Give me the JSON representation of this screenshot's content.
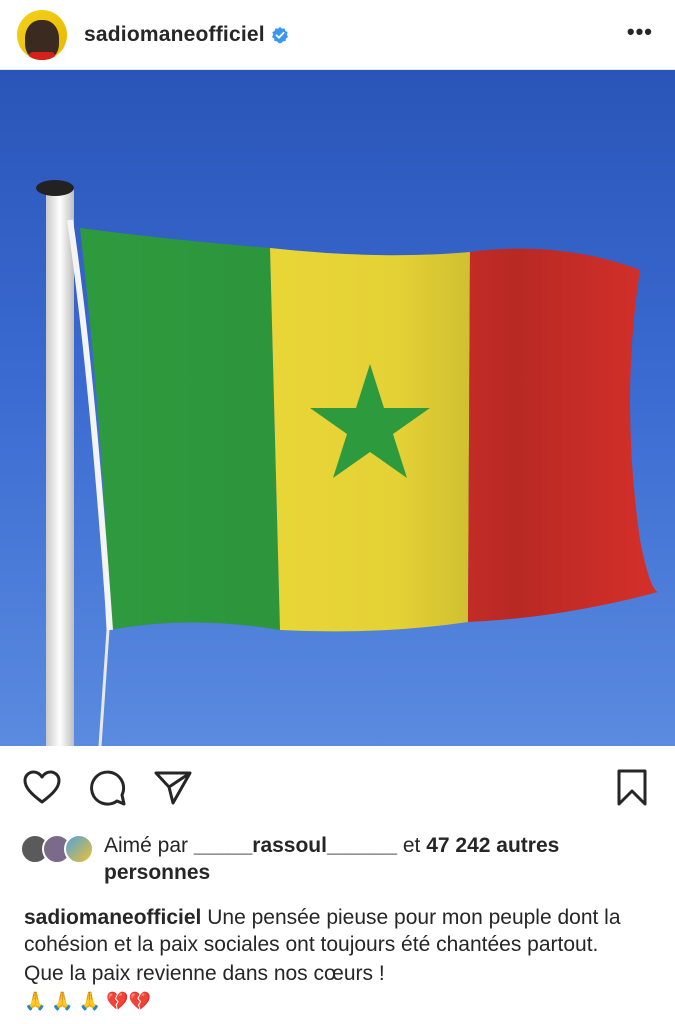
{
  "post": {
    "username": "sadiomaneofficiel",
    "verified_icon": "verified-badge-icon",
    "more_icon": "more-options-icon",
    "more_label": "•••"
  },
  "image": {
    "subject": "Senegal flag",
    "colors": {
      "green": "#2e9a3e",
      "yellow": "#f0dc38",
      "red": "#e0322c",
      "sky": "#2f5fc4"
    }
  },
  "actions": {
    "like_icon": "heart-icon",
    "comment_icon": "comment-icon",
    "share_icon": "send-icon",
    "save_icon": "bookmark-icon"
  },
  "likes": {
    "prefix": "Aimé par ",
    "user": "_____rassoul______",
    "middle": " et ",
    "count": "47 242 autres personnes"
  },
  "caption": {
    "username": "sadiomaneofficiel",
    "line1": " Une pensée pieuse pour mon peuple dont la cohésion et  la paix sociales ont toujours été chantées partout.",
    "line2": "Que la paix revienne dans nos cœurs !",
    "emojis": "🙏 🙏 🙏 💔💔"
  }
}
